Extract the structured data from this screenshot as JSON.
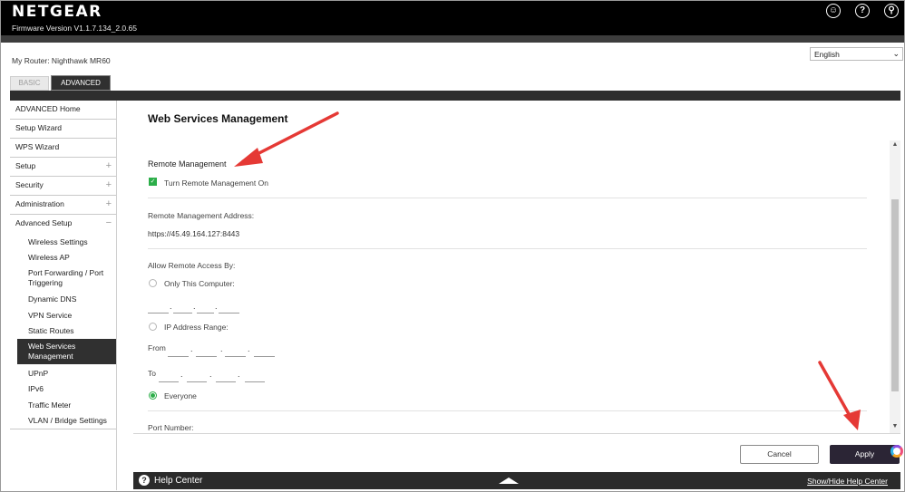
{
  "header": {
    "logo": "NETGEAR",
    "firmware": "Firmware Version V1.1.7.134_2.0.65",
    "icons": [
      "user-icon",
      "help-icon",
      "search-icon"
    ]
  },
  "router_label": "My Router: Nighthawk MR60",
  "language": {
    "selected": "English"
  },
  "tabs": [
    {
      "label": "BASIC",
      "active": false
    },
    {
      "label": "ADVANCED",
      "active": true
    }
  ],
  "sidebar": {
    "items": [
      {
        "label": "ADVANCED Home",
        "expander": ""
      },
      {
        "label": "Setup Wizard",
        "expander": ""
      },
      {
        "label": "WPS Wizard",
        "expander": ""
      },
      {
        "label": "Setup",
        "expander": "+"
      },
      {
        "label": "Security",
        "expander": "+"
      },
      {
        "label": "Administration",
        "expander": "+"
      },
      {
        "label": "Advanced Setup",
        "expander": "−"
      }
    ],
    "sub_items": [
      {
        "label": "Wireless Settings"
      },
      {
        "label": "Wireless AP"
      },
      {
        "label": "Port Forwarding / Port Triggering"
      },
      {
        "label": "Dynamic DNS"
      },
      {
        "label": "VPN Service"
      },
      {
        "label": "Static Routes"
      },
      {
        "label": "Web Services Management",
        "active": true
      },
      {
        "label": "UPnP"
      },
      {
        "label": "IPv6"
      },
      {
        "label": "Traffic Meter"
      },
      {
        "label": "VLAN / Bridge Settings"
      }
    ]
  },
  "main": {
    "title": "Web Services Management",
    "remote_section": "Remote Management",
    "remote_checkbox_label": "Turn Remote Management On",
    "remote_checkbox_checked": true,
    "address_label": "Remote Management Address:",
    "address_value": "https://45.49.164.127:8443",
    "access_label": "Allow Remote Access By:",
    "option_only": "Only This Computer:",
    "option_range": "IP Address Range:",
    "from_label": "From",
    "to_label": "To",
    "option_everyone": "Everyone",
    "selected_access": "Everyone",
    "port_label": "Port Number:"
  },
  "buttons": {
    "cancel": "Cancel",
    "apply": "Apply"
  },
  "help": {
    "label": "Help Center",
    "toggle": "Show/Hide Help Center"
  },
  "colors": {
    "accent_green": "#2cae49",
    "annotation_red": "#e53935",
    "header_black": "#000000",
    "apply_dark": "#2b2535"
  }
}
